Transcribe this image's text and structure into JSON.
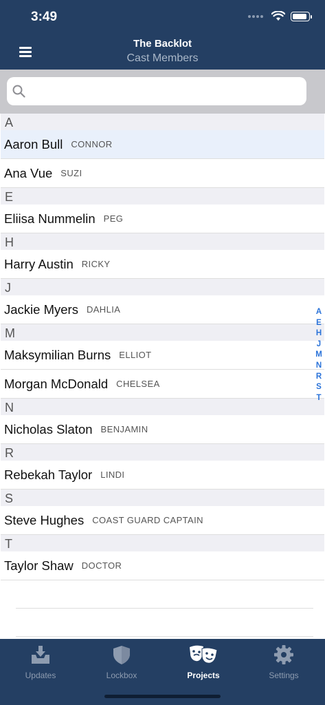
{
  "status_bar": {
    "time": "3:49"
  },
  "nav": {
    "title": "The Backlot",
    "subtitle": "Cast Members"
  },
  "search": {
    "placeholder": ""
  },
  "sections": [
    {
      "letter": "A",
      "rows": [
        {
          "name": "Aaron Bull",
          "role": "CONNOR",
          "selected": true
        },
        {
          "name": "Ana Vue",
          "role": "SUZI"
        }
      ]
    },
    {
      "letter": "E",
      "rows": [
        {
          "name": "Eliisa Nummelin",
          "role": "PEG"
        }
      ]
    },
    {
      "letter": "H",
      "rows": [
        {
          "name": "Harry Austin",
          "role": "RICKY"
        }
      ]
    },
    {
      "letter": "J",
      "rows": [
        {
          "name": "Jackie Myers",
          "role": "DAHLIA"
        }
      ]
    },
    {
      "letter": "M",
      "rows": [
        {
          "name": "Maksymilian Burns",
          "role": "ELLIOT"
        },
        {
          "name": "Morgan McDonald",
          "role": "CHELSEA"
        }
      ]
    },
    {
      "letter": "N",
      "rows": [
        {
          "name": "Nicholas Slaton",
          "role": "BENJAMIN"
        }
      ]
    },
    {
      "letter": "R",
      "rows": [
        {
          "name": "Rebekah Taylor",
          "role": "LINDI"
        }
      ]
    },
    {
      "letter": "S",
      "rows": [
        {
          "name": "Steve Hughes",
          "role": "COAST GUARD CAPTAIN"
        }
      ]
    },
    {
      "letter": "T",
      "rows": [
        {
          "name": "Taylor Shaw",
          "role": "DOCTOR"
        }
      ]
    }
  ],
  "index": [
    "A",
    "E",
    "H",
    "J",
    "M",
    "N",
    "R",
    "S",
    "T"
  ],
  "tabs": [
    {
      "label": "Updates",
      "icon": "inbox-download-icon",
      "active": false
    },
    {
      "label": "Lockbox",
      "icon": "shield-icon",
      "active": false
    },
    {
      "label": "Projects",
      "icon": "theater-masks-icon",
      "active": true
    },
    {
      "label": "Settings",
      "icon": "gear-icon",
      "active": false
    }
  ],
  "colors": {
    "nav_bg": "#243f63",
    "accent": "#2b73d9",
    "selected_row": "#e9f0fb"
  }
}
